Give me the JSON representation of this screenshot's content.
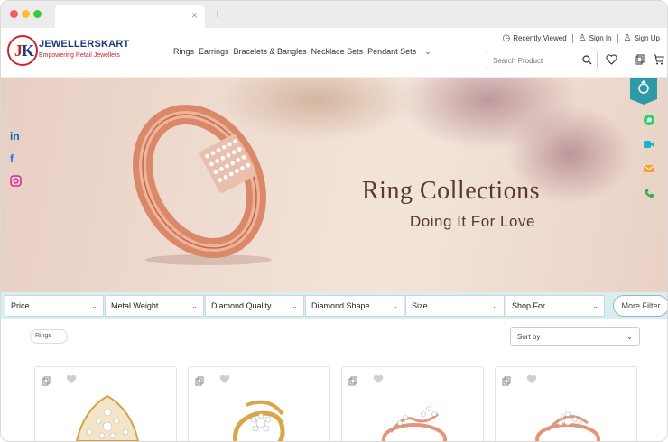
{
  "browser": {
    "tab_title": "",
    "tab_close": "×",
    "new_tab": "+"
  },
  "brand": {
    "name": "JEWELLERSKART",
    "tagline": "Empowering Retail Jewellers",
    "colors": {
      "red": "#c8252c",
      "navy": "#1b3b7a",
      "teal": "#2e9aa6"
    }
  },
  "nav": {
    "items": [
      "Rings",
      "Earrings",
      "Bracelets & Bangles",
      "Necklace Sets",
      "Pendant Sets"
    ],
    "more_icon": "chevron-down-icon"
  },
  "topbar": {
    "recently_viewed": "Recently Viewed",
    "sign_in": "Sign In",
    "sign_up": "Sign Up"
  },
  "search": {
    "placeholder": "Search Product"
  },
  "banner": {
    "title": "Ring Collections",
    "subtitle": "Doing It For Love"
  },
  "filters": {
    "items": [
      "Price",
      "Metal Weight",
      "Diamond Quality",
      "Diamond Shape",
      "Size",
      "Shop For"
    ],
    "more_label": "More Filter"
  },
  "listing": {
    "active_tag": "Rings",
    "sort_label": "Sort by",
    "product_count_visible": 4
  }
}
